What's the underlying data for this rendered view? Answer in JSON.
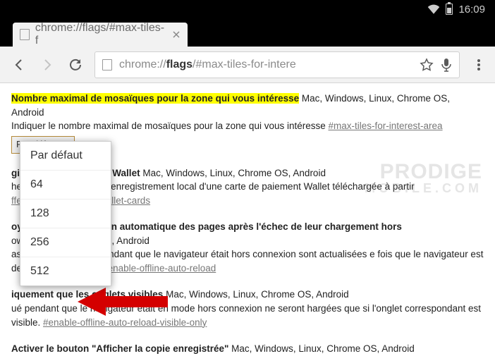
{
  "status": {
    "time": "16:09"
  },
  "tab": {
    "title": "chrome://flags/#max-tiles-f"
  },
  "omnibox": {
    "prefix": "chrome://",
    "bold": "flags",
    "suffix": "/#max-tiles-for-intere"
  },
  "select": {
    "label": "Par défaut"
  },
  "dropdown": {
    "items": [
      "Par défaut",
      "64",
      "128",
      "256",
      "512"
    ]
  },
  "flags": [
    {
      "title": "Nombre maximal de mosaïques pour la zone qui vous intéresse",
      "highlight": true,
      "platforms": "Mac, Windows, Linux, Chrome OS, Android",
      "desc": "Indiquer le nombre maximal de mosaïques pour la zone qui vous intéresse",
      "link": "#max-tiles-for-interest-area"
    },
    {
      "title": "gistrement des cartes Wallet",
      "platforms": "Mac, Windows, Linux, Chrome OS, Android",
      "desc": "heter pour proposer un enregistrement local d'une carte de paiement Wallet téléchargée à partir",
      "link": "ffer-store-unmasked-wallet-cards"
    },
    {
      "title": "oyant une actualisation automatique des pages après l'échec de leur chargement hors",
      "platforms": "ows, Linux, Chrome OS, Android",
      "desc": "as pu être chargées pendant que le navigateur était hors connexion sont actualisées e fois que le navigateur est de nouveau en ligne.",
      "link": "#enable-offline-auto-reload"
    },
    {
      "title": "iquement que les onglets visibles",
      "platforms": "Mac, Windows, Linux, Chrome OS, Android",
      "desc": "ué pendant que le navigateur était en mode hors connexion ne seront hargées que si l'onglet correspondant est visible.",
      "link": "#enable-offline-auto-reload-visible-only"
    },
    {
      "title": "Activer le bouton \"Afficher la copie enregistrée\"",
      "platforms": "Mac, Windows, Linux, Chrome OS, Android",
      "desc": ""
    }
  ],
  "watermark": {
    "line1": "PRODIGE",
    "line2": "MOBILE.COM"
  }
}
